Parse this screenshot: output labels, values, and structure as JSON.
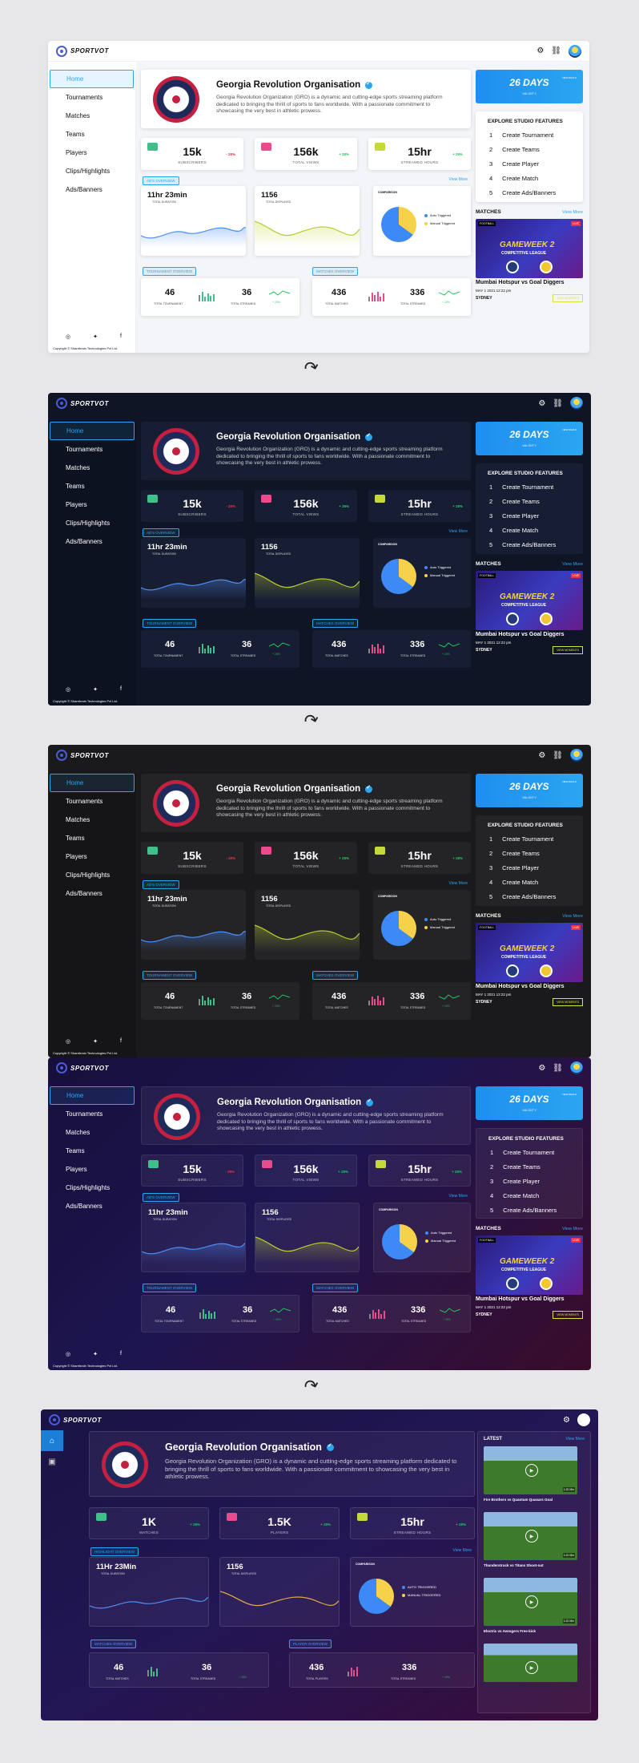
{
  "app": {
    "name": "SPORTVOT"
  },
  "sidebar": {
    "items": [
      "Home",
      "Tournaments",
      "Matches",
      "Teams",
      "Players",
      "Clips/Highlights",
      "Ads/Banners"
    ],
    "copyright": "Copyright © Sharebrain Technologies Pvt Ltd."
  },
  "org": {
    "name": "Georgia Revolution Organisation",
    "description": "Georgia Revolution Organization (GRO) is a dynamic and cutting-edge sports streaming platform dedicated to bringing the thrill of sports to fans worldwide. With a passionate commitment to showcasing the very best in athletic prowess."
  },
  "stats": [
    {
      "value": "15k",
      "label": "SUBSCRIBERS",
      "change": "- 28%",
      "color": "#e53447",
      "icon": "users-icon"
    },
    {
      "value": "156k",
      "label": "TOTAL VIEWS",
      "change": "+ 28%",
      "color": "#22c55e",
      "icon": "eye-icon"
    },
    {
      "value": "15hr",
      "label": "STREAMED HOURS",
      "change": "+ 28%",
      "color": "#22c55e",
      "icon": "clock-icon"
    }
  ],
  "stats5": [
    {
      "value": "1K",
      "label": "MATCHES",
      "change": "+ 28%"
    },
    {
      "value": "1.5K",
      "label": "PLAYERS",
      "change": "+ 28%"
    },
    {
      "value": "15hr",
      "label": "STREAMED HOURS",
      "change": "+ 28%"
    }
  ],
  "overview": {
    "tag": "AD'S OVERVIEW",
    "tag5": "HIGHLIGHT OVERVIEW",
    "view_more": "View More",
    "duration": {
      "value": "11hr 23min",
      "value5": "11Hr 23Min",
      "label": "TOTAL DURATION"
    },
    "displayed": {
      "value": "1156",
      "label": "TOTAL DISPLAYED"
    },
    "comparison": {
      "title": "COMPARISON",
      "auto": "Auto Triggered",
      "manual": "Manual Triggered",
      "auto_upper": "AUTO TRIGGERED",
      "manual_upper": "MANUAL TRIGGERED",
      "auto_share": 0.65
    }
  },
  "tournament": {
    "tag": "TOURNAMENT OVERVIEW",
    "tag5": "MATCHES OVERVIEW",
    "a_val": "46",
    "a_lbl": "TOTAL TOURNAMENT",
    "a_lbl5": "TOTAL MATCHES",
    "b_val": "36",
    "b_lbl": "TOTAL STREAMED",
    "b_chg": "+ 28%"
  },
  "matches_ov": {
    "tag": "MATCHES OVERVIEW",
    "tag5": "PLAYER OVERVIEW",
    "a_val": "436",
    "a_lbl": "TOTAL MATCHES",
    "a_lbl5": "TOTAL PLAYERS",
    "b_val": "336",
    "b_lbl": "TOTAL STREAMED",
    "b_chg": "+ 28%"
  },
  "validity": {
    "days": "26 DAYS",
    "label": "VALIDITY",
    "note": "NEW DEALS"
  },
  "explore": {
    "title": "EXPLORE STUDIO FEATURES",
    "items": [
      {
        "n": "1",
        "t": "Create Tournament"
      },
      {
        "n": "2",
        "t": "Create Teams"
      },
      {
        "n": "3",
        "t": "Create Player"
      },
      {
        "n": "4",
        "t": "Create Match"
      },
      {
        "n": "5",
        "t": "Create Ads/Banners"
      }
    ]
  },
  "matches": {
    "title": "MATCHES",
    "view_more": "View More",
    "card": {
      "football": "FOOTBALL",
      "live": "LIVE",
      "gameweek": "GAMEWEEK 2",
      "league": "COMPETITIVE LEAGUE",
      "title": "Mumbai Hotspur vs Goal Diggers",
      "date": "MAY 1 2021  12:22 pm",
      "location": "SYDNEY",
      "button": "VIEW MOMENTS"
    }
  },
  "latest": {
    "title": "LATEST",
    "view_more": "View More",
    "videos": [
      {
        "t": "Fire Brothers vs Quantum Quasars Goal",
        "d": "1:22 Min"
      },
      {
        "t": "Thunderstruck vs Titans Shoot-out",
        "d": "1:22 Min"
      },
      {
        "t": "Electric vs Avengers Free-kick",
        "d": "1:22 Min"
      },
      {
        "t": "",
        "d": ""
      }
    ]
  },
  "colors": {
    "accent": "#2aa6f1",
    "red": "#e53447",
    "green": "#22c55e",
    "yellow": "#f6d24a",
    "pie_blue": "#3d8af7"
  }
}
